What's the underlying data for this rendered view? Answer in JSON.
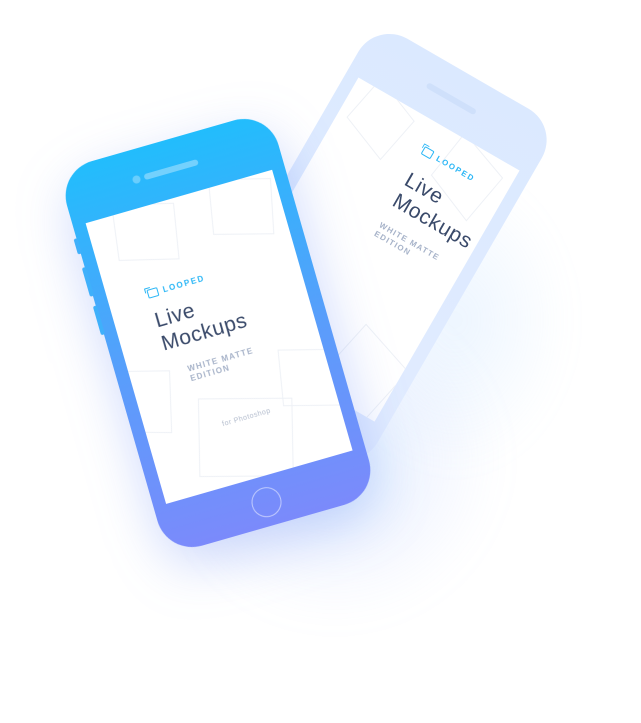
{
  "front_screen": {
    "brand": "LOOPED",
    "title_line1": "Live",
    "title_line2": "Mockups",
    "edition_line1": "WHITE MATTE",
    "edition_line2": "EDITION",
    "platform": "for Photoshop"
  },
  "back_screen": {
    "brand": "LOOPED",
    "title_line1": "Live",
    "title_line2": "Mockups",
    "edition_line1": "WHITE MATTE",
    "edition_line2": "EDITION"
  },
  "colors": {
    "front_phone_top": "#22bdfc",
    "front_phone_bottom": "#7b8afb",
    "back_phone": "#dbe9ff",
    "brand_accent": "#29b6f6",
    "title_text": "#3a4a6a",
    "subtitle_text": "#a7b3c9"
  },
  "icons": {
    "brand": "looped-logo-icon"
  }
}
